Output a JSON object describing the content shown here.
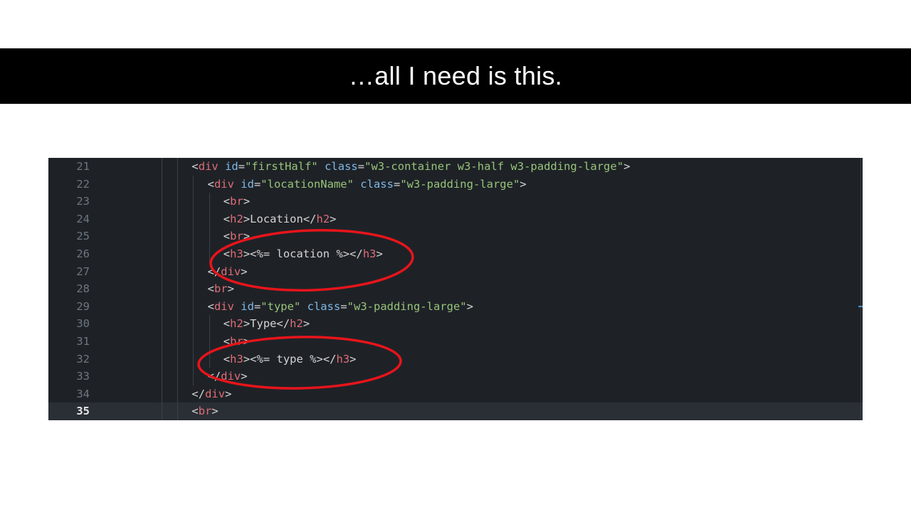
{
  "slide": {
    "title": "…all I need is this."
  },
  "code_editor": {
    "lines": [
      {
        "number": "21",
        "indent": 3,
        "tokens": [
          {
            "t": "<",
            "c": "punct"
          },
          {
            "t": "div",
            "c": "tag"
          },
          {
            "t": " ",
            "c": "text"
          },
          {
            "t": "id",
            "c": "attr"
          },
          {
            "t": "=",
            "c": "punct"
          },
          {
            "t": "\"firstHalf\"",
            "c": "str"
          },
          {
            "t": " ",
            "c": "text"
          },
          {
            "t": "class",
            "c": "attr"
          },
          {
            "t": "=",
            "c": "punct"
          },
          {
            "t": "\"w3-container w3-half w3-padding-large\"",
            "c": "str"
          },
          {
            "t": ">",
            "c": "punct"
          }
        ]
      },
      {
        "number": "22",
        "indent": 4,
        "tokens": [
          {
            "t": "<",
            "c": "punct"
          },
          {
            "t": "div",
            "c": "tag"
          },
          {
            "t": " ",
            "c": "text"
          },
          {
            "t": "id",
            "c": "attr"
          },
          {
            "t": "=",
            "c": "punct"
          },
          {
            "t": "\"locationName\"",
            "c": "str"
          },
          {
            "t": " ",
            "c": "text"
          },
          {
            "t": "class",
            "c": "attr"
          },
          {
            "t": "=",
            "c": "punct"
          },
          {
            "t": "\"w3-padding-large\"",
            "c": "str"
          },
          {
            "t": ">",
            "c": "punct"
          }
        ]
      },
      {
        "number": "23",
        "indent": 5,
        "tokens": [
          {
            "t": "<",
            "c": "punct"
          },
          {
            "t": "br",
            "c": "tag"
          },
          {
            "t": ">",
            "c": "punct"
          }
        ]
      },
      {
        "number": "24",
        "indent": 5,
        "tokens": [
          {
            "t": "<",
            "c": "punct"
          },
          {
            "t": "h2",
            "c": "tag"
          },
          {
            "t": ">",
            "c": "punct"
          },
          {
            "t": "Location",
            "c": "text"
          },
          {
            "t": "</",
            "c": "punct"
          },
          {
            "t": "h2",
            "c": "tag"
          },
          {
            "t": ">",
            "c": "punct"
          }
        ]
      },
      {
        "number": "25",
        "indent": 5,
        "tokens": [
          {
            "t": "<",
            "c": "punct"
          },
          {
            "t": "br",
            "c": "tag"
          },
          {
            "t": ">",
            "c": "punct"
          }
        ]
      },
      {
        "number": "26",
        "indent": 5,
        "tokens": [
          {
            "t": "<",
            "c": "punct"
          },
          {
            "t": "h3",
            "c": "tag"
          },
          {
            "t": ">",
            "c": "punct"
          },
          {
            "t": "<%= location %>",
            "c": "text"
          },
          {
            "t": "</",
            "c": "punct"
          },
          {
            "t": "h3",
            "c": "tag"
          },
          {
            "t": ">",
            "c": "punct"
          }
        ]
      },
      {
        "number": "27",
        "indent": 4,
        "tokens": [
          {
            "t": "</",
            "c": "punct"
          },
          {
            "t": "div",
            "c": "tag"
          },
          {
            "t": ">",
            "c": "punct"
          }
        ]
      },
      {
        "number": "28",
        "indent": 4,
        "tokens": [
          {
            "t": "<",
            "c": "punct"
          },
          {
            "t": "br",
            "c": "tag"
          },
          {
            "t": ">",
            "c": "punct"
          }
        ]
      },
      {
        "number": "29",
        "indent": 4,
        "tokens": [
          {
            "t": "<",
            "c": "punct"
          },
          {
            "t": "div",
            "c": "tag"
          },
          {
            "t": " ",
            "c": "text"
          },
          {
            "t": "id",
            "c": "attr"
          },
          {
            "t": "=",
            "c": "punct"
          },
          {
            "t": "\"type\"",
            "c": "str"
          },
          {
            "t": " ",
            "c": "text"
          },
          {
            "t": "class",
            "c": "attr"
          },
          {
            "t": "=",
            "c": "punct"
          },
          {
            "t": "\"w3-padding-large\"",
            "c": "str"
          },
          {
            "t": ">",
            "c": "punct"
          }
        ]
      },
      {
        "number": "30",
        "indent": 5,
        "tokens": [
          {
            "t": "<",
            "c": "punct"
          },
          {
            "t": "h2",
            "c": "tag"
          },
          {
            "t": ">",
            "c": "punct"
          },
          {
            "t": "Type",
            "c": "text"
          },
          {
            "t": "</",
            "c": "punct"
          },
          {
            "t": "h2",
            "c": "tag"
          },
          {
            "t": ">",
            "c": "punct"
          }
        ]
      },
      {
        "number": "31",
        "indent": 5,
        "tokens": [
          {
            "t": "<",
            "c": "punct"
          },
          {
            "t": "br",
            "c": "tag"
          },
          {
            "t": ">",
            "c": "punct"
          }
        ]
      },
      {
        "number": "32",
        "indent": 5,
        "tokens": [
          {
            "t": "<",
            "c": "punct"
          },
          {
            "t": "h3",
            "c": "tag"
          },
          {
            "t": ">",
            "c": "punct"
          },
          {
            "t": "<%= type %>",
            "c": "text"
          },
          {
            "t": "</",
            "c": "punct"
          },
          {
            "t": "h3",
            "c": "tag"
          },
          {
            "t": ">",
            "c": "punct"
          }
        ]
      },
      {
        "number": "33",
        "indent": 4,
        "tokens": [
          {
            "t": "</",
            "c": "punct"
          },
          {
            "t": "div",
            "c": "tag"
          },
          {
            "t": ">",
            "c": "punct"
          }
        ]
      },
      {
        "number": "34",
        "indent": 3,
        "tokens": [
          {
            "t": "</",
            "c": "punct"
          },
          {
            "t": "div",
            "c": "tag"
          },
          {
            "t": ">",
            "c": "punct"
          }
        ]
      },
      {
        "number": "35",
        "indent": 3,
        "current": true,
        "tokens": [
          {
            "t": "<",
            "c": "punct"
          },
          {
            "t": "br",
            "c": "tag"
          },
          {
            "t": ">",
            "c": "punct"
          }
        ]
      }
    ],
    "annotations": [
      {
        "type": "ellipse",
        "label": "location-highlight",
        "color": "#e8141b"
      },
      {
        "type": "ellipse",
        "label": "type-highlight",
        "color": "#e8141b"
      }
    ]
  }
}
